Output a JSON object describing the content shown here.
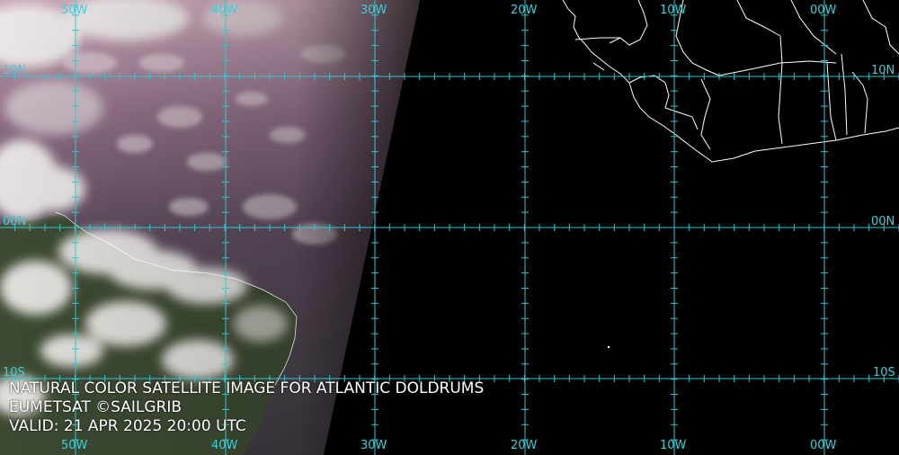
{
  "caption": {
    "title": "NATURAL COLOR SATELLITE IMAGE FOR ATLANTIC DOLDRUMS",
    "credit": "EUMETSAT ©SAILGRIB",
    "valid": "VALID:  21 APR 2025 20:00 UTC"
  },
  "grid": {
    "longitudes": [
      "50W",
      "40W",
      "30W",
      "20W",
      "10W",
      "00W"
    ],
    "latitudes": [
      "10N",
      "00N",
      "10S"
    ]
  },
  "colors": {
    "grid_line": "#2fc8d2",
    "grid_label": "#34d3dc",
    "coastline": "#ffffff",
    "night_side": "#000000"
  }
}
